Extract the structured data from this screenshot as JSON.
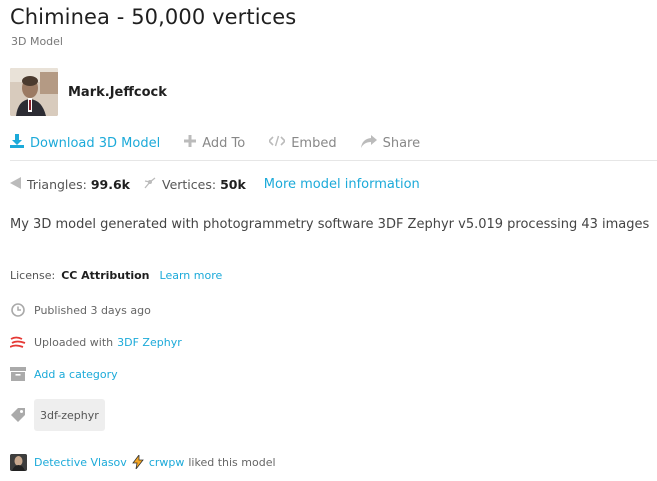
{
  "model": {
    "title": "Chiminea - 50,000 vertices",
    "type_label": "3D Model"
  },
  "author": {
    "name": "Mark.Jeffcock"
  },
  "actions": {
    "download": "Download 3D Model",
    "add_to": "Add To",
    "embed": "Embed",
    "share": "Share"
  },
  "stats": {
    "triangles_label": "Triangles:",
    "triangles_value": "99.6k",
    "vertices_label": "Vertices:",
    "vertices_value": "50k",
    "more_info": "More model information"
  },
  "description": "My 3D model generated with photogrammetry software 3DF Zephyr v5.019 processing 43 images",
  "license": {
    "label": "License:",
    "name": "CC Attribution",
    "learn_more": "Learn more"
  },
  "meta": {
    "published": "Published 3 days ago",
    "uploaded_prefix": "Uploaded with",
    "uploaded_app": "3DF Zephyr",
    "add_category": "Add a category"
  },
  "tags": [
    "3df-zephyr"
  ],
  "likes": {
    "user1": "Detective Vlasov",
    "user2": "crwpw",
    "suffix": "liked this model"
  },
  "colors": {
    "accent": "#1caad9",
    "zephyr_red": "#e53935",
    "lightning": "#f5a623"
  }
}
